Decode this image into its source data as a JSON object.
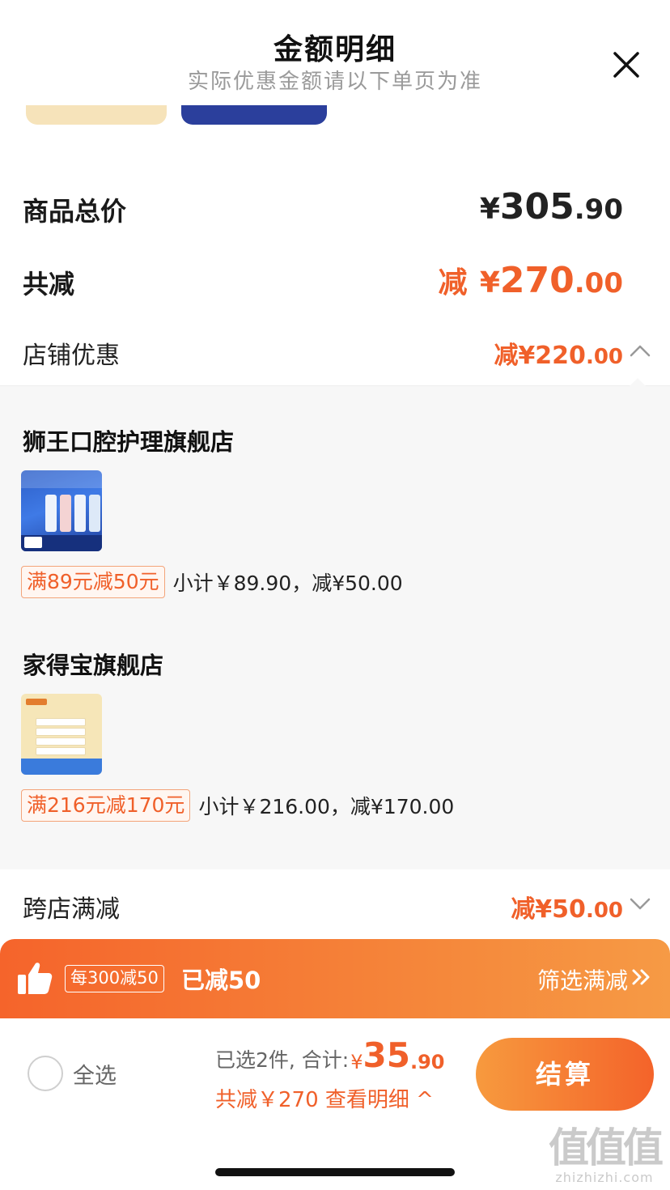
{
  "header": {
    "title": "金额明细",
    "subtitle": "实际优惠金额请以下单页为准",
    "close_icon": "close-icon"
  },
  "summary_rows": {
    "total": {
      "label": "商品总价",
      "currency": "¥",
      "integer": "305",
      "decimal": ".90"
    },
    "reduce": {
      "label": "共减",
      "prefix": "减",
      "currency": "¥",
      "integer": "270",
      "decimal": ".00"
    },
    "shop_discount": {
      "label": "店铺优惠",
      "value": "减¥220",
      "decimal": ".00",
      "expanded": true
    },
    "cross_store": {
      "label": "跨店满减",
      "value": "减¥50",
      "decimal": ".00",
      "expanded": false
    }
  },
  "stores": [
    {
      "name": "狮王口腔护理旗舰店",
      "thumbnail": "toothpaste-product-image",
      "promo_tag": "满89元减50元",
      "subtotal": "小计￥89.90，减¥50.00"
    },
    {
      "name": "家得宝旗舰店",
      "thumbnail": "wipes-product-image",
      "promo_tag": "满216元减170元",
      "subtotal": "小计￥216.00，减¥170.00"
    }
  ],
  "promo_bar": {
    "icon": "thumbs-up-icon",
    "rule_tag": "每300减50",
    "reduced_text": "已减50",
    "filter_label": "筛选满减",
    "filter_icon": "double-chevron-right-icon"
  },
  "bottom_bar": {
    "select_all_label": "全选",
    "selected_text": "已选2件, 合计:",
    "currency": "¥",
    "amount_integer": "35",
    "amount_decimal": ".90",
    "detail_text": "共减￥270  查看明细 ^",
    "checkout_label": "结算"
  },
  "watermark": {
    "logo": "值值值",
    "text": "zhizhizhi.com"
  },
  "colors": {
    "accent": "#f0602a",
    "promo_bar_start": "#f5642b",
    "promo_bar_end": "#f69a45",
    "section_bg": "#f7f7f7"
  }
}
